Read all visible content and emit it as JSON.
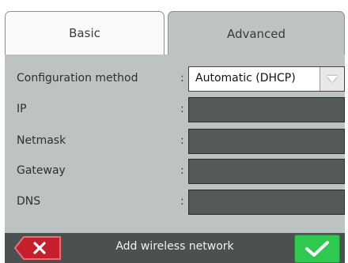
{
  "tabs": [
    {
      "label": "Basic"
    },
    {
      "label": "Advanced"
    }
  ],
  "form": {
    "configuration_method": {
      "label": "Configuration method",
      "colon": ":",
      "value": "Automatic (DHCP)"
    },
    "ip": {
      "label": "IP",
      "colon": ":",
      "value": ""
    },
    "netmask": {
      "label": "Netmask",
      "colon": ":",
      "value": ""
    },
    "gateway": {
      "label": "Gateway",
      "colon": ":",
      "value": ""
    },
    "dns": {
      "label": "DNS",
      "colon": ":",
      "value": ""
    }
  },
  "bottom_bar": {
    "title": "Add wireless network",
    "cancel_icon": "close-icon",
    "confirm_icon": "checkmark-icon"
  },
  "colors": {
    "panel": "#bdc3c3",
    "field": "#535a57",
    "cancel": "#c41f2c",
    "confirm": "#2fc94f",
    "bar": "#4b5150"
  }
}
